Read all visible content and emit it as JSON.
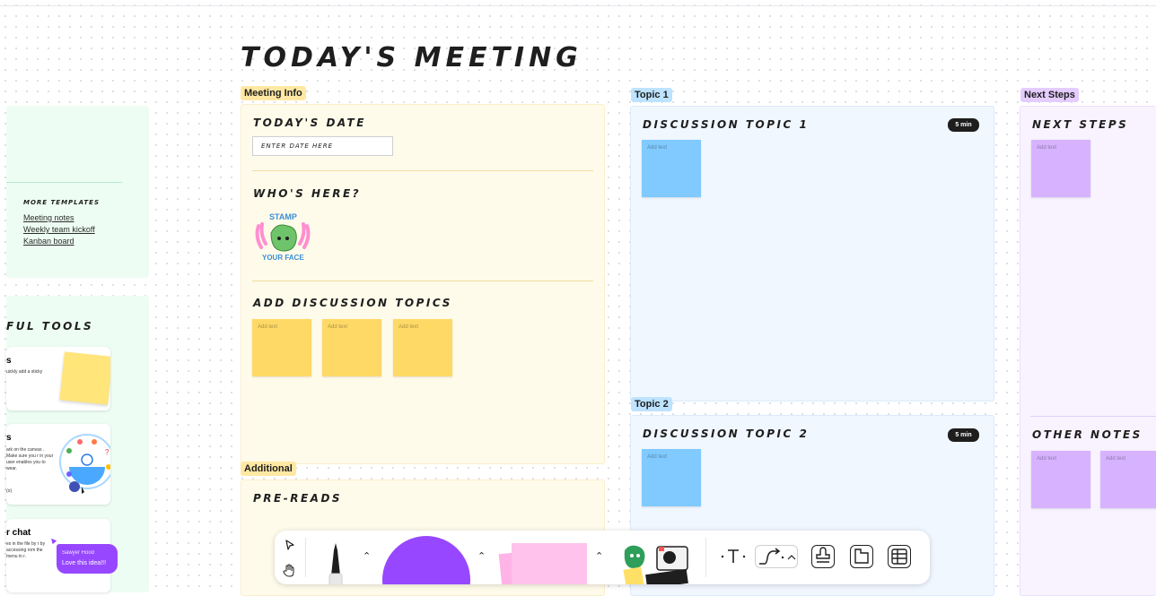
{
  "title": "Today's Meeting",
  "left_panel": {
    "more_templates_heading": "More Templates",
    "links": [
      "Meeting notes",
      "Weekly team kickoff",
      "Kanban board"
    ],
    "tools_heading": "ful tools",
    "cards": [
      {
        "title": "s",
        "desc": "uickly add a sticky"
      },
      {
        "title": "s",
        "desc": "ark on the canvas . Make sure you r in your user enables you to wear."
      },
      {
        "title": "r chat",
        "desc": "es in the file by r by accessing rom the menu in r."
      }
    ],
    "card2_footer": "(o)",
    "chat_name": "Sawyer Hood",
    "chat_message": "Love this idea!!!"
  },
  "meeting_info": {
    "tag": "Meeting Info",
    "date_heading": "Today's Date",
    "date_placeholder": "Enter date here",
    "whos_here_heading": "Who's here?",
    "stamp_text_top": "STAMP",
    "stamp_text_bottom": "YOUR FACE",
    "topics_heading": "Add Discussion Topics",
    "sticky_text": "Add text"
  },
  "additional": {
    "tag": "Additional",
    "heading": "Pre-reads"
  },
  "topic1": {
    "tag": "Topic 1",
    "heading": "Discussion Topic 1",
    "time": "5 min",
    "sticky_text": "Add text"
  },
  "topic2": {
    "tag": "Topic 2",
    "heading": "Discussion Topic 2",
    "time": "5 min",
    "sticky_text": "Add text"
  },
  "next_steps": {
    "tag": "Next Steps",
    "heading": "Next Steps",
    "other_heading": "Other Notes",
    "sticky_text": "Add text"
  },
  "toolbar": {
    "tools": [
      "select-tool",
      "hand-tool",
      "marker-tool",
      "shape-tool",
      "sticky-tool",
      "stamp-sticker-tool",
      "text-tool",
      "connector-tool",
      "stamp-tool",
      "section-tool",
      "table-tool"
    ]
  },
  "colors": {
    "meeting_bg": "#fffbea",
    "topic_bg": "#f0f7ff",
    "next_bg": "#f8f3ff",
    "left_bg": "#edfdf3",
    "sticky_yellow": "#ffd966",
    "sticky_blue": "#80caff",
    "sticky_purple": "#d7b3ff",
    "shape_purple": "#9747ff"
  }
}
